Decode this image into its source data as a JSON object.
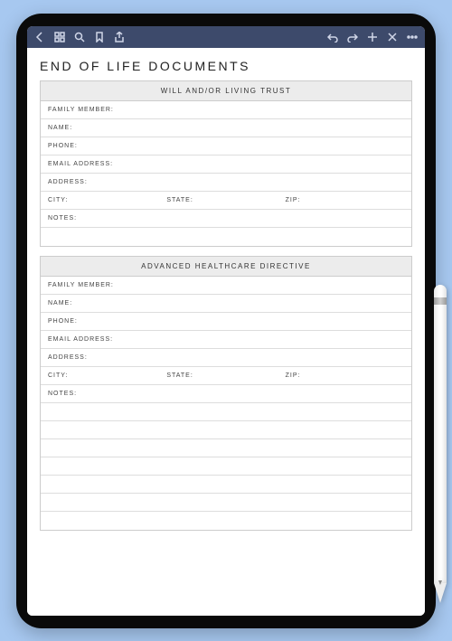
{
  "document": {
    "title": "END OF LIFE DOCUMENTS",
    "sections": [
      {
        "heading": "WILL AND/OR LIVING TRUST",
        "fields": {
          "family_member": "FAMILY MEMBER:",
          "name": "NAME:",
          "phone": "PHONE:",
          "email": "EMAIL ADDRESS:",
          "address": "ADDRESS:",
          "city": "CITY:",
          "state": "STATE:",
          "zip": "ZIP:",
          "notes": "NOTES:"
        },
        "notes_lines": 2
      },
      {
        "heading": "ADVANCED HEALTHCARE DIRECTIVE",
        "fields": {
          "family_member": "FAMILY MEMBER:",
          "name": "NAME:",
          "phone": "PHONE:",
          "email": "EMAIL ADDRESS:",
          "address": "ADDRESS:",
          "city": "CITY:",
          "state": "STATE:",
          "zip": "ZIP:",
          "notes": "NOTES:"
        },
        "notes_lines": 7
      }
    ]
  },
  "toolbar": {
    "icons_left": [
      "back",
      "grid",
      "search",
      "bookmark",
      "share"
    ],
    "icons_right": [
      "undo",
      "redo",
      "add",
      "close",
      "more"
    ]
  }
}
